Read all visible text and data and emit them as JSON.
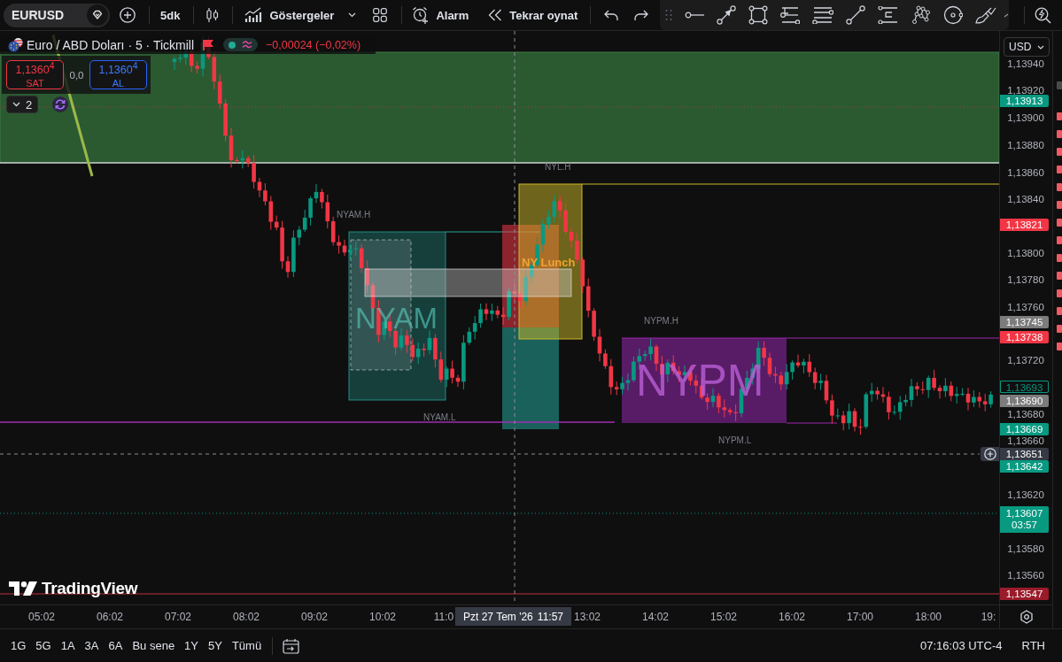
{
  "toolbar": {
    "symbol": "EURUSD",
    "interval": "5dk",
    "indicators": "Göstergeler",
    "alert": "Alarm",
    "replay": "Tekrar oynat"
  },
  "legend": {
    "title": "Euro / ABD Doları · 5 · Tickmill",
    "change": "−0,00024 (−0,02%)",
    "sell": {
      "price": "1,1360$^{4}$",
      "label": "SAT"
    },
    "spread": "0,0",
    "buy": {
      "price": "1,1360$^{4}$",
      "label": "AL"
    },
    "indicator_count": "2"
  },
  "chart": {
    "sessions": [
      {
        "name": "NYAM",
        "high_label": "NYAM.H",
        "low_label": "NYAM.L"
      },
      {
        "name": "NY Lunch",
        "high_label": "NYL.H"
      },
      {
        "name": "NYPM",
        "high_label": "NYPM.H",
        "low_label": "NYPM.L"
      }
    ],
    "logo": "TradingView"
  },
  "price_axis": {
    "currency": "USD",
    "ticks": [
      "1,13940",
      "1,13920",
      "1,13900",
      "1,13880",
      "1,13860",
      "1,13840",
      "1,13800",
      "1,13780",
      "1,13760",
      "1,13720",
      "1,13680",
      "1,13660",
      "1,13620",
      "1,13580",
      "1,13560"
    ],
    "badges": [
      {
        "text": "1,13913",
        "kind": "filled",
        "color": "#089981"
      },
      {
        "text": "1,13821",
        "kind": "filled",
        "color": "#f23645"
      },
      {
        "text": "1,13745",
        "kind": "filled",
        "color": "#7c7c7c"
      },
      {
        "text": "1,13738",
        "kind": "filled",
        "color": "#f23645"
      },
      {
        "text": "1,13693",
        "kind": "outline",
        "color": "#089981"
      },
      {
        "text": "1,13690",
        "kind": "filled",
        "color": "#7c7c7c"
      },
      {
        "text": "1,13669",
        "kind": "filled",
        "color": "#089981"
      },
      {
        "text": "1,13651",
        "kind": "crosshair",
        "color": "#363a45"
      },
      {
        "text": "1,13642",
        "kind": "filled",
        "color": "#089981"
      },
      {
        "text": "1,13607",
        "countdown": "03:57",
        "kind": "filled",
        "color": "#089981"
      },
      {
        "text": "1,13547",
        "kind": "filled",
        "color": "#9a1b29"
      }
    ]
  },
  "time_axis": {
    "ticks": [
      "05:02",
      "06:02",
      "07:02",
      "08:02",
      "09:02",
      "10:02",
      "11:0",
      "13:02",
      "14:02",
      "15:02",
      "16:02",
      "17:00",
      "18:00",
      "19:"
    ],
    "crosshair": {
      "date": "Pzt 27 Tem '26",
      "time": "11:57"
    }
  },
  "bottom_bar": {
    "ranges": [
      "1G",
      "5G",
      "1A",
      "3A",
      "6A",
      "Bu sene",
      "1Y",
      "5Y",
      "Tümü"
    ],
    "clock": "07:16:03 UTC-4",
    "session": "RTH"
  }
}
